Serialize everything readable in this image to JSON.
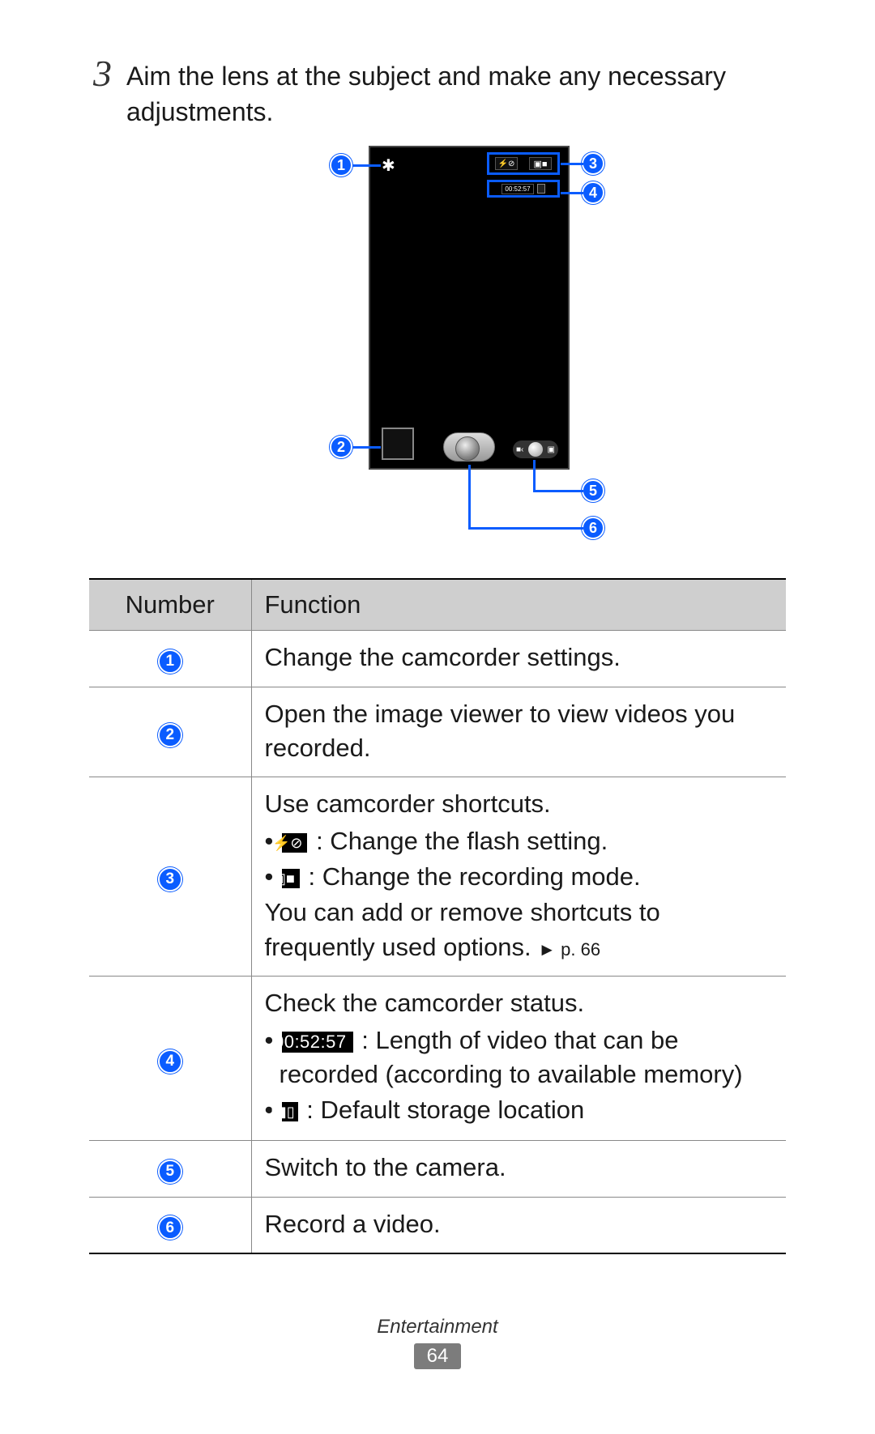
{
  "step": {
    "number": "3",
    "text": "Aim the lens at the subject and make any necessary adjustments."
  },
  "diagram": {
    "callouts": [
      "1",
      "2",
      "3",
      "4",
      "5",
      "6"
    ],
    "status_time": "00:52:57"
  },
  "table": {
    "headers": {
      "number": "Number",
      "function": "Function"
    },
    "rows": [
      {
        "num": "1",
        "lines": [
          "Change the camcorder settings."
        ]
      },
      {
        "num": "2",
        "lines": [
          "Open the image viewer to view videos you recorded."
        ]
      },
      {
        "num": "3",
        "intro": "Use camcorder shortcuts.",
        "bullets": [
          {
            "icon": "flash",
            "text": " : Change the flash setting."
          },
          {
            "icon": "recmode",
            "text": " : Change the recording mode."
          }
        ],
        "outro_a": "You can add or remove shortcuts to frequently used options. ",
        "outro_link": "► p. 66"
      },
      {
        "num": "4",
        "intro": "Check the camcorder status.",
        "bullets": [
          {
            "icon": "time",
            "icon_text": "00:52:57",
            "text": " : Length of video that can be recorded (according to available memory)"
          },
          {
            "icon": "storage",
            "text": " : Default storage location"
          }
        ]
      },
      {
        "num": "5",
        "lines": [
          "Switch to the camera."
        ]
      },
      {
        "num": "6",
        "lines": [
          "Record a video."
        ]
      }
    ]
  },
  "footer": {
    "section": "Entertainment",
    "page": "64"
  }
}
